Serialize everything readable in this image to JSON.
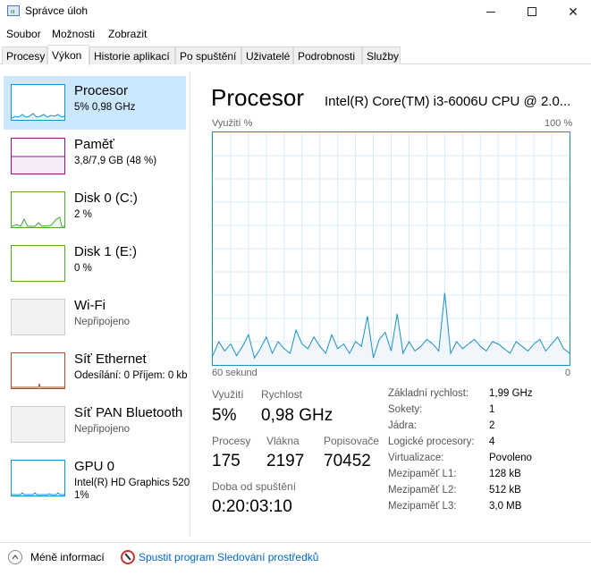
{
  "window": {
    "title": "Správce úloh"
  },
  "menu": [
    "Soubor",
    "Možnosti",
    "Zobrazit"
  ],
  "tabs": [
    "Procesy",
    "Výkon",
    "Historie aplikací",
    "Po spuštění",
    "Uživatelé",
    "Podrobnosti",
    "Služby"
  ],
  "sidebar": {
    "items": [
      {
        "name": "Procesor",
        "sub": "5% 0,98 GHz",
        "color": "#1d8fc9",
        "active": true
      },
      {
        "name": "Paměť",
        "sub": "3,8/7,9 GB (48 %)",
        "color": "#8b1a8b"
      },
      {
        "name": "Disk 0 (C:)",
        "sub": "2 %",
        "color": "#4ea72e"
      },
      {
        "name": "Disk 1 (E:)",
        "sub": "0 %",
        "color": "#4ea72e"
      },
      {
        "name": "Wi-Fi",
        "sub": "Nepřipojeno",
        "color": "#cccccc"
      },
      {
        "name": "Síť Ethernet",
        "sub": "Odesílání: 0 Příjem: 0 kb",
        "color": "#a0522d"
      },
      {
        "name": "Síť PAN Bluetooth",
        "sub": "Nepřipojeno",
        "color": "#cccccc"
      },
      {
        "name": "GPU 0",
        "sub": "Intel(R) HD Graphics 520",
        "sub2": "1%",
        "color": "#1d8fc9"
      }
    ]
  },
  "main": {
    "title": "Procesor",
    "model": "Intel(R) Core(TM) i3-6006U CPU @ 2.0...",
    "graph": {
      "top_left": "Využití %",
      "top_right": "100 %",
      "bottom_left": "60 sekund",
      "bottom_right": "0",
      "values": [
        4,
        10,
        6,
        9,
        4,
        8,
        13,
        3,
        7,
        12,
        5,
        10,
        7,
        5,
        15,
        9,
        7,
        12,
        8,
        5,
        13,
        7,
        9,
        5,
        10,
        8,
        21,
        3,
        11,
        14,
        6,
        22,
        5,
        10,
        6,
        8,
        11,
        9,
        6,
        31,
        5,
        10,
        7,
        9,
        11,
        8,
        6,
        10,
        9,
        7,
        5,
        10,
        8,
        6,
        9,
        11,
        6,
        9,
        12,
        7,
        5
      ]
    },
    "stats": {
      "utilization_label": "Využití",
      "utilization": "5%",
      "speed_label": "Rychlost",
      "speed": "0,98 GHz",
      "processes_label": "Procesy",
      "processes": "175",
      "threads_label": "Vlákna",
      "threads": "2197",
      "handles_label": "Popisovače",
      "handles": "70452",
      "uptime_label": "Doba od spuštění",
      "uptime": "0:20:03:10"
    },
    "properties": [
      {
        "label": "Základní rychlost:",
        "value": "1,99 GHz"
      },
      {
        "label": "Sokety:",
        "value": "1"
      },
      {
        "label": "Jádra:",
        "value": "2"
      },
      {
        "label": "Logické procesory:",
        "value": "4"
      },
      {
        "label": "Virtualizace:",
        "value": "Povoleno"
      },
      {
        "label": "Mezipaměť L1:",
        "value": "128 kB"
      },
      {
        "label": "Mezipaměť L2:",
        "value": "512 kB"
      },
      {
        "label": "Mezipaměť L3:",
        "value": "3,0 MB"
      }
    ]
  },
  "footer": {
    "less": "Méně informací",
    "monitor": "Spustit program Sledování prostředků"
  }
}
